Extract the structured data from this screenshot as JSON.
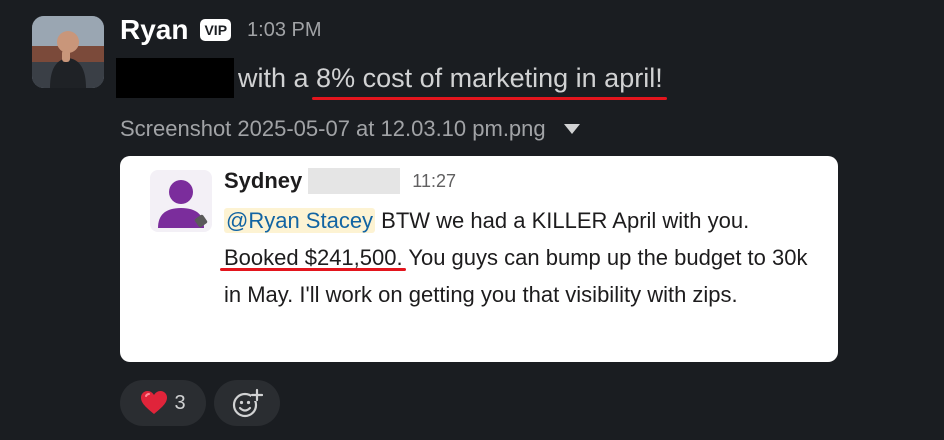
{
  "message": {
    "sender": "Ryan",
    "badge": "VIP",
    "time": "1:03 PM",
    "text_prefix": "with a ",
    "text_highlight": "8% cost of marketing in april!"
  },
  "attachment": {
    "filename": "Screenshot 2025-05-07 at 12.03.10 pm.png"
  },
  "embedded": {
    "sender": "Sydney",
    "time": "11:27",
    "mention": "@Ryan Stacey",
    "text_1": " BTW we had a KILLER April with you.",
    "booked": "Booked $241,500.",
    "text_2": " You guys can bump up the budget to 30k in May. I'll work on getting you that visibility with zips."
  },
  "reactions": [
    {
      "icon": "heart-icon",
      "count": "3"
    },
    {
      "icon": "add-reaction-icon"
    }
  ],
  "colors": {
    "background": "#1a1d21",
    "underline": "#e3151d",
    "mention_text": "#1264a3",
    "mention_bg": "#fdf3d3"
  }
}
